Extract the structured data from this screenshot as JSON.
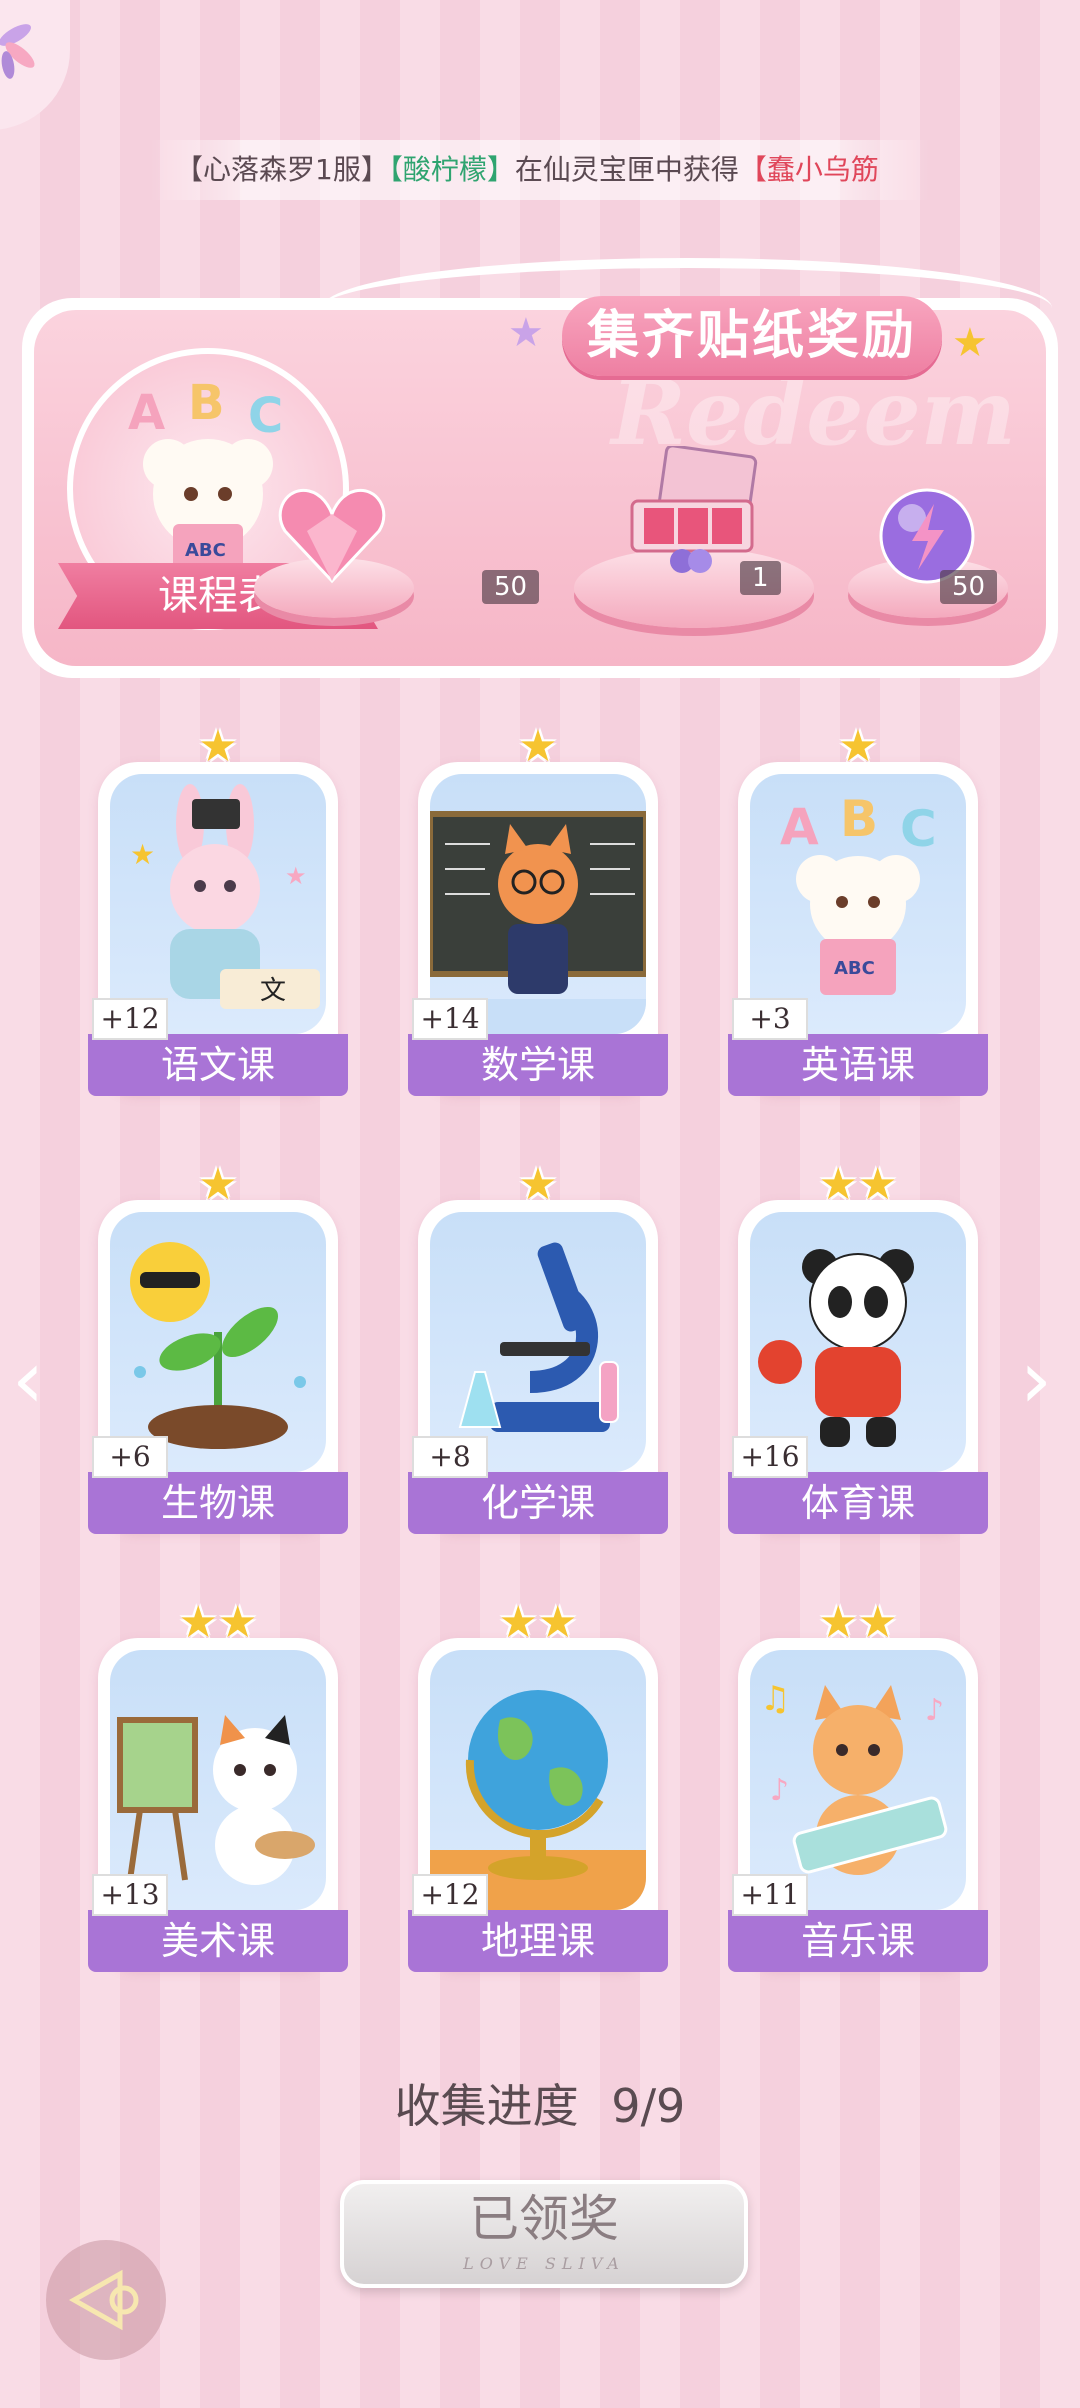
{
  "ticker": {
    "server": "【心落森罗1服】",
    "player": "【酸柠檬】",
    "action": "在仙灵宝匣中获得",
    "item": "【蠢小乌筋"
  },
  "banner": {
    "title": "集齐贴纸奖励",
    "watermark": "Redeem",
    "schedule_label": "课程表",
    "rewards": [
      {
        "icon": "pink-heart-gem-icon",
        "count": "50"
      },
      {
        "icon": "gift-box-icon",
        "count": "1"
      },
      {
        "icon": "purple-lightning-orb-icon",
        "count": "50"
      }
    ]
  },
  "cards": [
    {
      "label": "语文课",
      "bonus": "+12",
      "stars": "★",
      "art": "bunny-calligraphy-icon"
    },
    {
      "label": "数学课",
      "bonus": "+14",
      "stars": "★",
      "art": "fox-teacher-icon"
    },
    {
      "label": "英语课",
      "bonus": "+3",
      "stars": "★",
      "art": "poodle-abc-icon"
    },
    {
      "label": "生物课",
      "bonus": "+6",
      "stars": "★",
      "art": "sun-sprout-icon"
    },
    {
      "label": "化学课",
      "bonus": "+8",
      "stars": "★",
      "art": "microscope-icon"
    },
    {
      "label": "体育课",
      "bonus": "+16",
      "stars": "★★",
      "art": "panda-pingpong-icon"
    },
    {
      "label": "美术课",
      "bonus": "+13",
      "stars": "★★",
      "art": "cat-painter-icon"
    },
    {
      "label": "地理课",
      "bonus": "+12",
      "stars": "★★",
      "art": "globe-icon"
    },
    {
      "label": "音乐课",
      "bonus": "+11",
      "stars": "★★",
      "art": "cat-keyboard-icon"
    }
  ],
  "progress": {
    "label": "收集进度",
    "value": "9/9"
  },
  "claim": {
    "label": "已领奖",
    "sub": "LOVE SLIVA"
  },
  "nav": {
    "prev": "‹",
    "next": "›"
  },
  "colors": {
    "accent_purple": "#a974d6",
    "ribbon_pink": "#ee7fa2",
    "star_gold": "#f6c430"
  }
}
